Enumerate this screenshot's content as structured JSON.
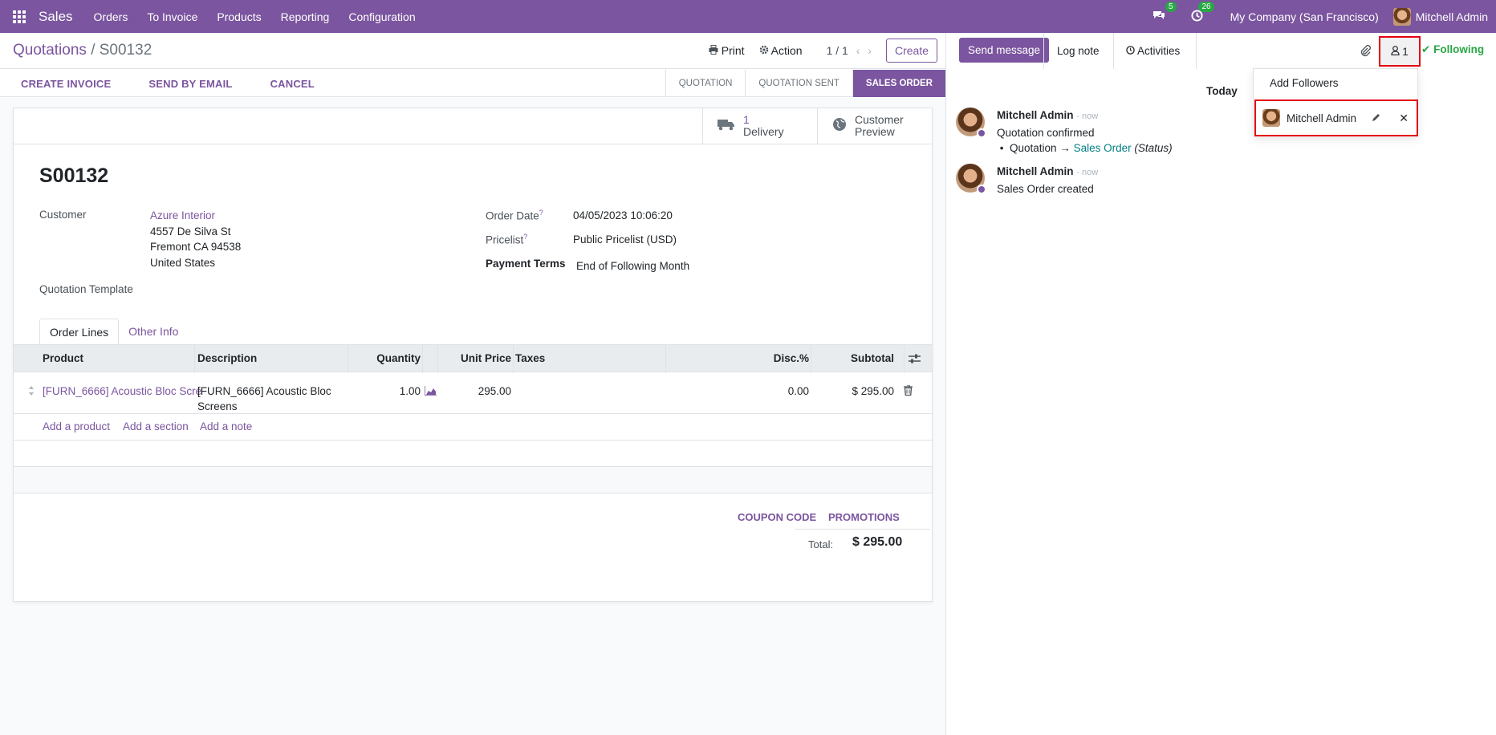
{
  "navbar": {
    "app_name": "Sales",
    "menu": [
      "Orders",
      "To Invoice",
      "Products",
      "Reporting",
      "Configuration"
    ],
    "messages_count": "5",
    "activities_count": "26",
    "company": "My Company (San Francisco)",
    "user": "Mitchell Admin"
  },
  "control_panel": {
    "breadcrumb_parent": "Quotations",
    "breadcrumb_sep": "/",
    "breadcrumb_current": "S00132",
    "print_label": "Print",
    "action_label": "Action",
    "pager": "1 / 1",
    "create_label": "Create"
  },
  "statusbar": {
    "buttons": [
      "CREATE INVOICE",
      "SEND BY EMAIL",
      "CANCEL"
    ],
    "stages": [
      "QUOTATION",
      "QUOTATION SENT",
      "SALES ORDER"
    ],
    "active_stage": "SALES ORDER"
  },
  "smart_buttons": {
    "delivery_count": "1",
    "delivery_label": "Delivery",
    "preview_line1": "Customer",
    "preview_line2": "Preview"
  },
  "form": {
    "name": "S00132",
    "customer_label": "Customer",
    "customer_name": "Azure Interior",
    "address_line1": "4557 De Silva St",
    "address_line2": "Fremont CA 94538",
    "address_line3": "United States",
    "template_label": "Quotation Template",
    "order_date_label": "Order Date",
    "order_date": "04/05/2023 10:06:20",
    "pricelist_label": "Pricelist",
    "pricelist": "Public Pricelist (USD)",
    "payment_terms_label": "Payment Terms",
    "payment_terms": "End of Following Month",
    "help_mark": "?"
  },
  "tabs": [
    "Order Lines",
    "Other Info"
  ],
  "order_lines": {
    "headers": [
      "Product",
      "Description",
      "Quantity",
      "Unit Price",
      "Taxes",
      "Disc.%",
      "Subtotal"
    ],
    "rows": [
      {
        "product": "[FURN_6666] Acoustic Bloc Scre",
        "description_line1": "[FURN_6666] Acoustic Bloc",
        "description_line2": "Screens",
        "quantity": "1.00",
        "unit_price": "295.00",
        "taxes": "",
        "discount": "0.00",
        "subtotal": "$ 295.00"
      }
    ],
    "add_product": "Add a product",
    "add_section": "Add a section",
    "add_note": "Add a note"
  },
  "totals": {
    "coupon_code": "COUPON CODE",
    "promotions": "PROMOTIONS",
    "total_label": "Total:",
    "total_value": "$ 295.00"
  },
  "chatter": {
    "send_message": "Send message",
    "log_note": "Log note",
    "activities": "Activities",
    "followers_count": "1",
    "following": "Following",
    "add_followers": "Add Followers",
    "follower_name": "Mitchell Admin",
    "today": "Today",
    "messages": [
      {
        "author": "Mitchell Admin",
        "date": "- now",
        "body": "Quotation confirmed",
        "tracking_old": "Quotation",
        "tracking_arrow": "→",
        "tracking_new": "Sales Order",
        "tracking_field": "(Status)"
      },
      {
        "author": "Mitchell Admin",
        "date": "- now",
        "body": "Sales Order created"
      }
    ]
  },
  "colors": {
    "brand": "#7b559f",
    "success": "#28a745",
    "highlight": "#e3000f",
    "tracking_new": "#017e84"
  }
}
